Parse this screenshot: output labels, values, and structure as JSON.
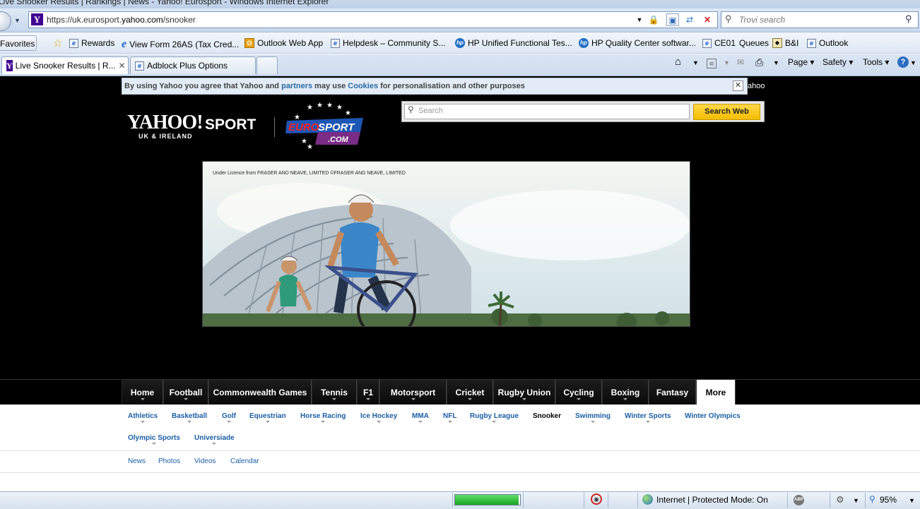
{
  "window": {
    "title": "Live Snooker Results | Rankings | News - Yahoo! Eurosport - Windows Internet Explorer"
  },
  "address_bar": {
    "url_prefix": "https://uk.eurosport.",
    "url_domain": "yahoo.com",
    "url_path": "/snooker"
  },
  "search_box": {
    "placeholder": "Trovi search"
  },
  "favorites": {
    "button_label": "Favorites",
    "items": [
      {
        "label": "Rewards",
        "icon": "ie-page-icon"
      },
      {
        "label": "View Form 26AS (Tax Cred...",
        "icon": "ie-logo-icon"
      },
      {
        "label": "Outlook Web App",
        "icon": "outlook-icon"
      },
      {
        "label": "Helpdesk – Community S...",
        "icon": "ie-page-icon"
      },
      {
        "label": "HP Unified Functional Tes...",
        "icon": "hp-icon"
      },
      {
        "label": "HP Quality Center softwar...",
        "icon": "hp-icon"
      },
      {
        "label": "CE01",
        "icon": "ie-page-icon"
      },
      {
        "label": "Queues",
        "icon": ""
      },
      {
        "label": "B&I",
        "icon": "bi-icon"
      },
      {
        "label": "Outlook",
        "icon": "ie-page-icon"
      }
    ]
  },
  "tabs": [
    {
      "label": "Live Snooker Results | R..."
    },
    {
      "label": "Adblock Plus Options"
    }
  ],
  "command_bar": {
    "page": "Page",
    "safety": "Safety",
    "tools": "Tools"
  },
  "cookie_bar": {
    "text_1": "By using Yahoo you agree that Yahoo and ",
    "link_partners": "partners",
    "text_2": " may use ",
    "link_cookies": "Cookies",
    "text_3": " for personalisation and other purposes",
    "right_text": "ahoo"
  },
  "logo": {
    "yahoo": "YAHOO!",
    "sport": "SPORT",
    "region": "UK & IRELAND",
    "euro_line1": "EURO",
    "euro_line2": "SPORT",
    "euro_line3": ".COM"
  },
  "search": {
    "placeholder": "Search",
    "button": "Search Web"
  },
  "ad": {
    "licence": "Under Licence from FRASER AND NEAVE, LIMITED ©FRASER AND NEAVE, LIMITED"
  },
  "nav": [
    {
      "label": "Home"
    },
    {
      "label": "Football"
    },
    {
      "label": "Commonwealth Games"
    },
    {
      "label": "Tennis"
    },
    {
      "label": "F1"
    },
    {
      "label": "Motorsport"
    },
    {
      "label": "Cricket"
    },
    {
      "label": "Rugby Union"
    },
    {
      "label": "Cycling"
    },
    {
      "label": "Boxing"
    },
    {
      "label": "Fantasy"
    },
    {
      "label": "More"
    }
  ],
  "subnav": [
    {
      "label": "Athletics"
    },
    {
      "label": "Basketball"
    },
    {
      "label": "Golf"
    },
    {
      "label": "Equestrian"
    },
    {
      "label": "Horse Racing"
    },
    {
      "label": "Ice Hockey"
    },
    {
      "label": "MMA"
    },
    {
      "label": "NFL"
    },
    {
      "label": "Rugby League"
    },
    {
      "label": "Snooker"
    },
    {
      "label": "Swimming"
    },
    {
      "label": "Winter Sports"
    },
    {
      "label": "Winter Olympics"
    },
    {
      "label": "Olympic Sports"
    },
    {
      "label": "Universiade"
    }
  ],
  "tertiary": [
    {
      "label": "News"
    },
    {
      "label": "Photos"
    },
    {
      "label": "Videos"
    },
    {
      "label": "Calendar"
    }
  ],
  "status": {
    "zone": "Internet | Protected Mode: On",
    "zoom": "95%",
    "load_progress": 0.98
  }
}
